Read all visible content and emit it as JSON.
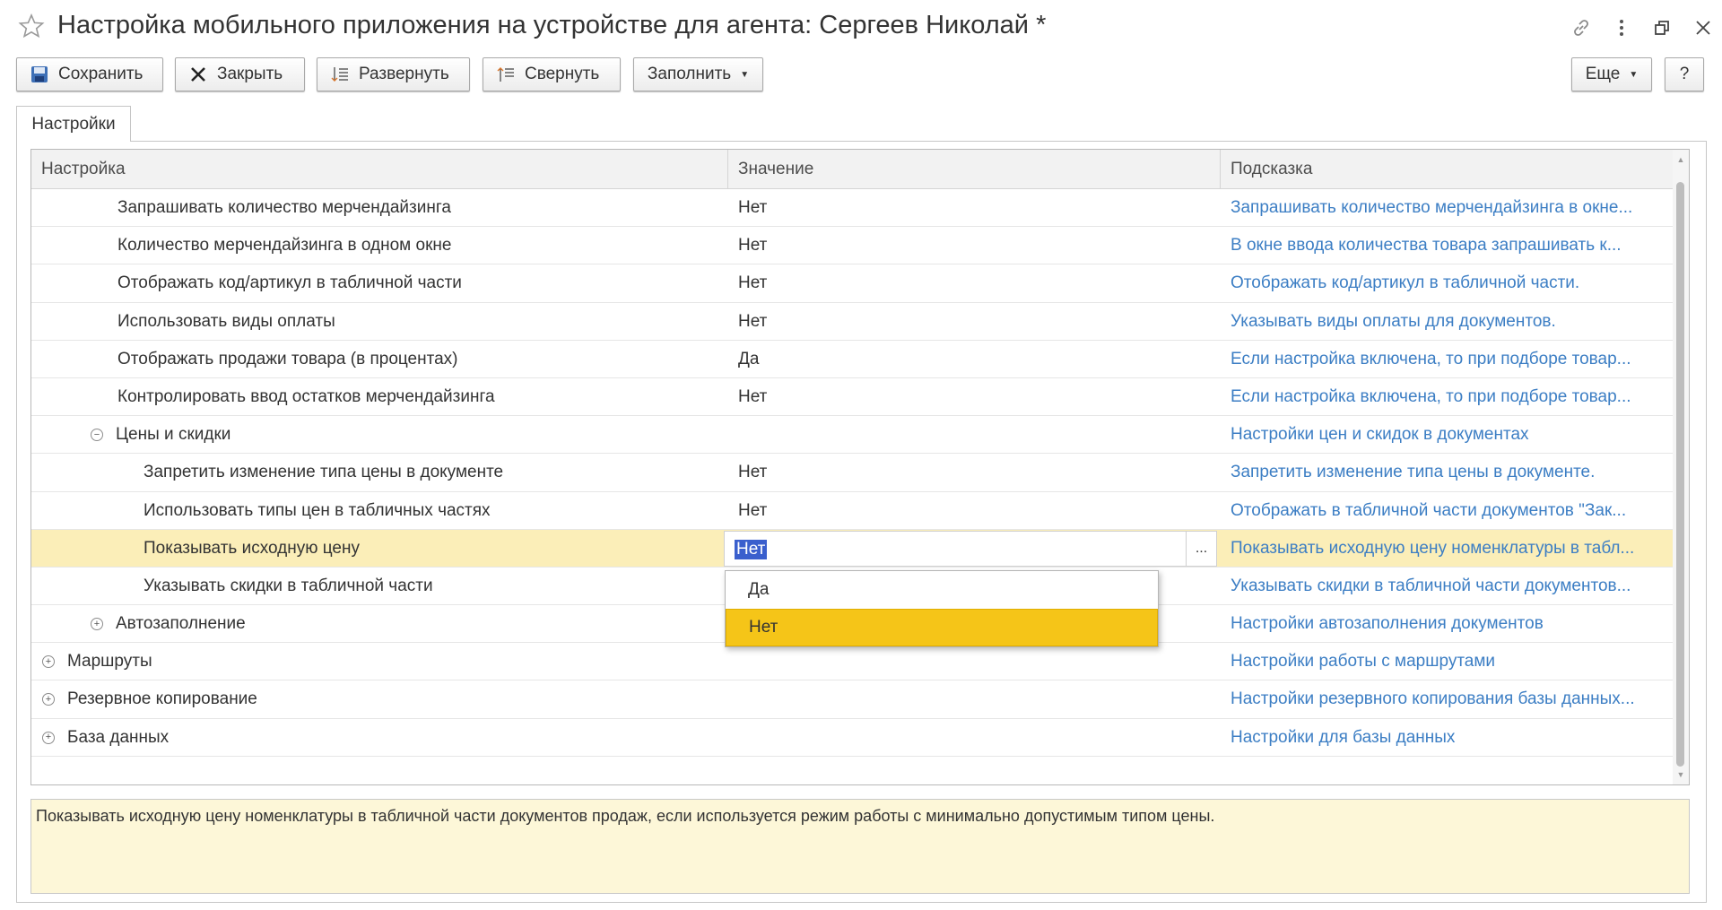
{
  "window": {
    "title": "Настройка мобильного приложения на устройстве для агента: Сергеев Николай *"
  },
  "toolbar": {
    "save": "Сохранить",
    "close": "Закрыть",
    "expand": "Развернуть",
    "collapse": "Свернуть",
    "fill": "Заполнить",
    "more": "Еще",
    "help": "?"
  },
  "tabs": [
    {
      "label": "Настройки"
    }
  ],
  "grid": {
    "columns": [
      "Настройка",
      "Значение",
      "Подсказка"
    ],
    "rows": [
      {
        "name": "Запрашивать количество мерчендайзинга",
        "value": "Нет",
        "hint": "Запрашивать количество мерчендайзинга в окне...",
        "level": 2
      },
      {
        "name": "Количество мерчендайзинга в одном окне",
        "value": "Нет",
        "hint": "В окне ввода количества товара запрашивать к...",
        "level": 2
      },
      {
        "name": "Отображать код/артикул в табличной части",
        "value": "Нет",
        "hint": "Отображать код/артикул в табличной части.",
        "level": 2
      },
      {
        "name": "Использовать виды оплаты",
        "value": "Нет",
        "hint": "Указывать виды оплаты для документов.",
        "level": 2
      },
      {
        "name": "Отображать продажи товара (в процентах)",
        "value": "Да",
        "hint": "Если настройка включена, то при подборе товар...",
        "level": 2
      },
      {
        "name": "Контролировать ввод остатков мерчендайзинга",
        "value": "Нет",
        "hint": "Если настройка включена, то при подборе товар...",
        "level": 2
      },
      {
        "name": "Цены и скидки",
        "value": "",
        "hint": "Настройки цен и скидок в документах",
        "level": 1,
        "expander": "⊖"
      },
      {
        "name": "Запретить изменение типа цены в документе",
        "value": "Нет",
        "hint": "Запретить изменение типа цены в документе.",
        "level": 3
      },
      {
        "name": "Использовать типы цен в табличных частях",
        "value": "Нет",
        "hint": "Отображать в табличной части документов \"Зак...",
        "level": 3
      },
      {
        "name": "Показывать исходную цену",
        "value": "Нет",
        "hint": "Показывать исходную цену номенклатуры в табл...",
        "level": 3,
        "selected": true
      },
      {
        "name": "Указывать скидки в табличной части",
        "value": "",
        "hint": "Указывать скидки в табличной части документов...",
        "level": 3
      },
      {
        "name": "Автозаполнение",
        "value": "",
        "hint": "Настройки автозаполнения документов",
        "level": 1,
        "expander": "⊕"
      },
      {
        "name": "Маршруты",
        "value": "",
        "hint": "Настройки работы с маршрутами",
        "level": 0,
        "expander": "⊕"
      },
      {
        "name": "Резервное копирование",
        "value": "",
        "hint": "Настройки резервного копирования базы данных...",
        "level": 0,
        "expander": "⊕"
      },
      {
        "name": "База данных",
        "value": "",
        "hint": "Настройки для базы данных",
        "level": 0,
        "expander": "⊕"
      }
    ]
  },
  "dropdown": {
    "options": [
      "Да",
      "Нет"
    ],
    "selected": "Нет"
  },
  "hint_text": "Показывать исходную цену номенклатуры в табличной части документов продаж, если используется режим работы с минимально допустимым типом цены.",
  "colors": {
    "hint_link": "#3c7ec4",
    "selected_row": "#fbeeb8",
    "dropdown_active": "#f5c518",
    "hint_panel": "#fdf7d8"
  }
}
